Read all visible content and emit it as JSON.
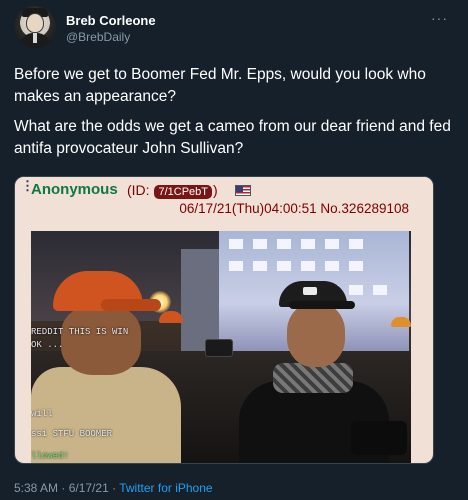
{
  "author": {
    "name": "Breb Corleone",
    "handle": "@BrebDaily",
    "avatar_icon": "avatar-icon"
  },
  "more_icon": "···",
  "tweet": {
    "paragraphs": [
      "Before we get to Boomer Fed Mr. Epps, would you look who makes an appearance?",
      "What are the odds we get a cameo from our dear friend and fed antifa provocateur John Sullivan?"
    ]
  },
  "media": {
    "post_name": "Anonymous",
    "id_prefix": "(ID:",
    "id_value": "7/1CPebT",
    "id_suffix": ")",
    "flag_icon": "us-flag-icon",
    "datetime_number": "06/17/21(Thu)04:00:51 No.326289108",
    "overlay_lines": [
      {
        "text": "REDDIT THIS IS WIN",
        "style": "white"
      },
      {
        "text": "OK ...",
        "style": "white"
      },
      {
        "text": "will",
        "style": "white"
      },
      {
        "text": "ssi STFU BOOMER",
        "style": "white"
      },
      {
        "text": "llowed!",
        "style": "green"
      }
    ]
  },
  "footer": {
    "time": "5:38 AM",
    "sep1": " · ",
    "date": "6/17/21",
    "sep2": " · ",
    "source": "Twitter for iPhone"
  },
  "colors": {
    "background": "#15202b",
    "link": "#1da1f2",
    "muted": "#8899a6",
    "chan_bg": "#f0e0d6",
    "chan_name": "#117743",
    "chan_date": "#800000"
  }
}
